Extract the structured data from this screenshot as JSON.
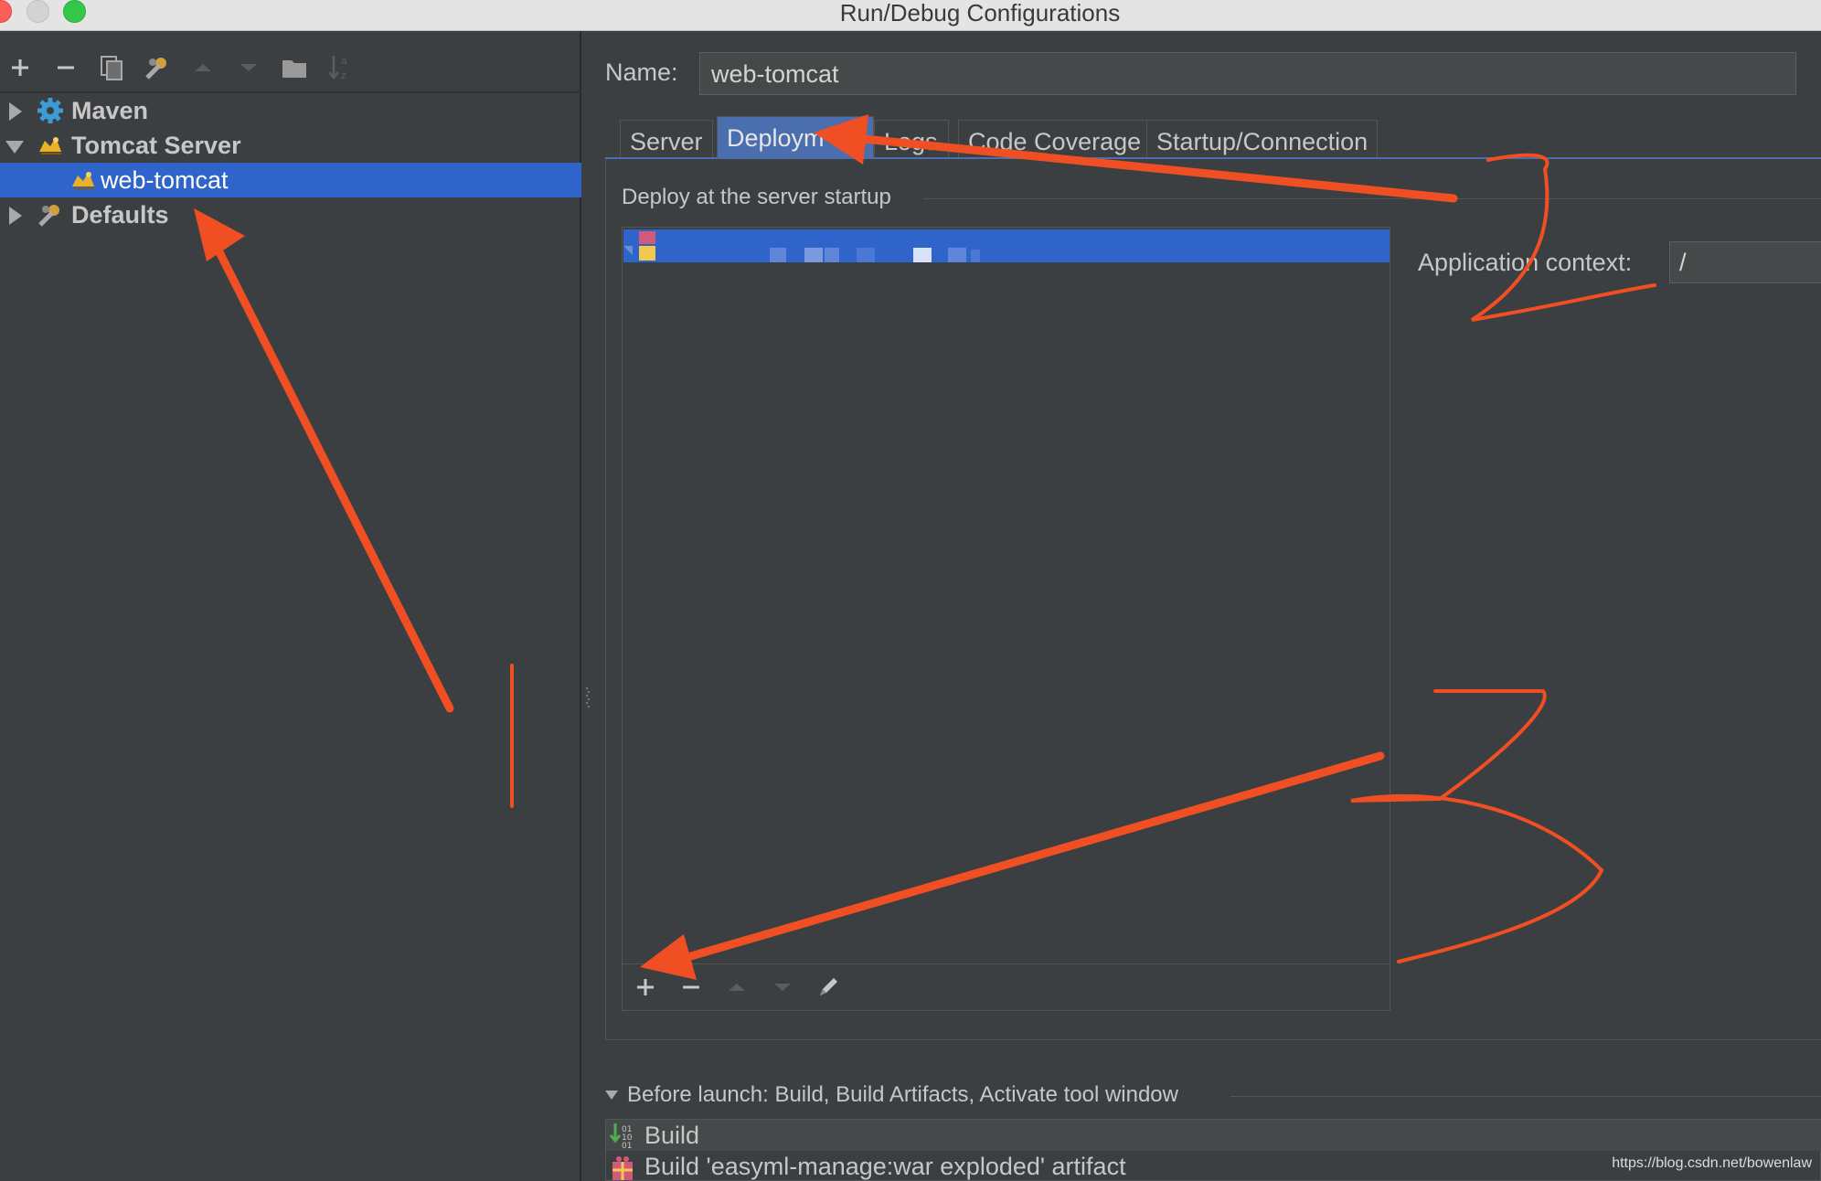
{
  "window": {
    "title": "Run/Debug Configurations"
  },
  "toolbar": {
    "icons": [
      "add-icon",
      "remove-icon",
      "copy-icon",
      "wrench-icon",
      "move-up-icon",
      "move-down-icon",
      "folder-icon",
      "sort-icon"
    ]
  },
  "tree": {
    "items": [
      {
        "label": "Maven",
        "icon": "gear-icon",
        "expanded": false,
        "selected": false
      },
      {
        "label": "Tomcat Server",
        "icon": "tomcat-icon",
        "expanded": true,
        "selected": false
      },
      {
        "label": "web-tomcat",
        "icon": "tomcat-icon",
        "selected": true
      },
      {
        "label": "Defaults",
        "icon": "wrench-icon",
        "expanded": false,
        "selected": false
      }
    ]
  },
  "config": {
    "name_label": "Name:",
    "name_value": "web-tomcat",
    "tabs": [
      {
        "label": "Server",
        "active": false
      },
      {
        "label": "Deploym",
        "active": true
      },
      {
        "label": "Logs",
        "active": false
      },
      {
        "label": "Code Coverage",
        "active": false
      },
      {
        "label": "Startup/Connection",
        "active": false
      }
    ]
  },
  "deployment": {
    "group_label": "Deploy at the server startup",
    "app_context_label": "Application context:",
    "app_context_value": "/",
    "list_toolbar": [
      "add-icon",
      "remove-icon",
      "move-up-icon",
      "move-down-icon",
      "edit-icon"
    ]
  },
  "before_launch": {
    "label": "Before launch: Build, Build Artifacts, Activate tool window",
    "items": [
      {
        "label": "Build",
        "icon": "build-icon"
      },
      {
        "label": "Build 'easyml-manage:war exploded' artifact",
        "icon": "artifact-icon"
      }
    ]
  },
  "watermark": "https://blog.csdn.net/bowenlaw",
  "colors": {
    "selection": "#2f65ca",
    "annotation": "#f04e23",
    "background": "#3c3f41"
  }
}
